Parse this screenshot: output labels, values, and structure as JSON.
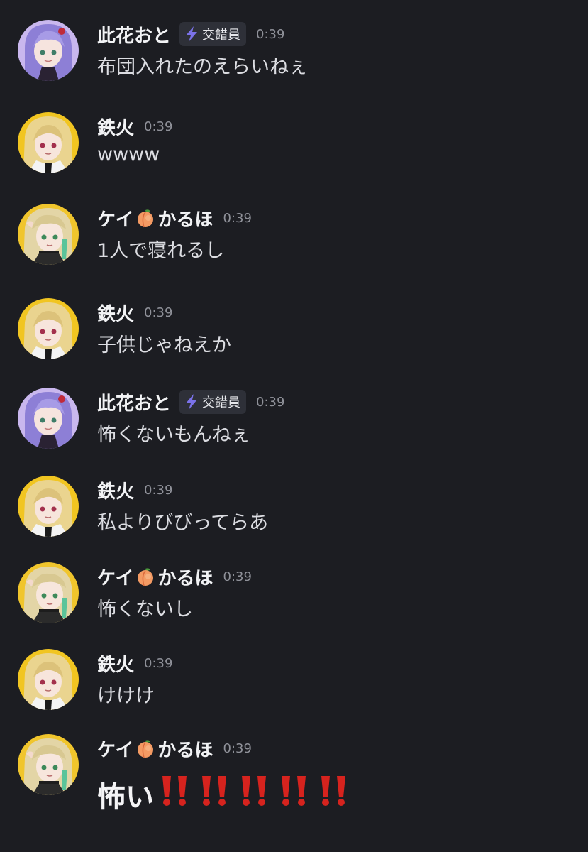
{
  "colors": {
    "background": "#1c1d22",
    "username": "#f2f3f5",
    "message": "#dcdde2",
    "timestamp": "#8f9199",
    "badge_bg": "#2e3038",
    "bolt": "#7b72e9",
    "bang": "#d6231e"
  },
  "messages": [
    {
      "avatar": "purple-hair-avatar",
      "username": "此花おと",
      "badge": "交錯員",
      "time": "0:39",
      "text": "布団入れたのえらいねぇ"
    },
    {
      "avatar": "blonde-avatar",
      "username": "鉄火",
      "time": "0:39",
      "text": "wwww"
    },
    {
      "avatar": "blonde-green-avatar",
      "username_before": "ケイ",
      "username_emoji": "peach-icon",
      "username_after": "かるほ",
      "time": "0:39",
      "text": "1人で寝れるし"
    },
    {
      "avatar": "blonde-avatar",
      "username": "鉄火",
      "time": "0:39",
      "text": "子供じゃねえか"
    },
    {
      "avatar": "purple-hair-avatar",
      "username": "此花おと",
      "badge": "交錯員",
      "time": "0:39",
      "text": "怖くないもんねぇ"
    },
    {
      "avatar": "blonde-avatar",
      "username": "鉄火",
      "time": "0:39",
      "text": "私よりびびってらあ"
    },
    {
      "avatar": "blonde-green-avatar",
      "username_before": "ケイ",
      "username_emoji": "peach-icon",
      "username_after": "かるほ",
      "time": "0:39",
      "text": "怖くないし"
    },
    {
      "avatar": "blonde-avatar",
      "username": "鉄火",
      "time": "0:39",
      "text": "けけけ"
    },
    {
      "avatar": "blonde-green-avatar",
      "username_before": "ケイ",
      "username_emoji": "peach-icon",
      "username_after": "かるほ",
      "time": "0:39",
      "text": "怖い",
      "emoji": "double-exclamation-icon",
      "emoji_count": 5
    }
  ]
}
